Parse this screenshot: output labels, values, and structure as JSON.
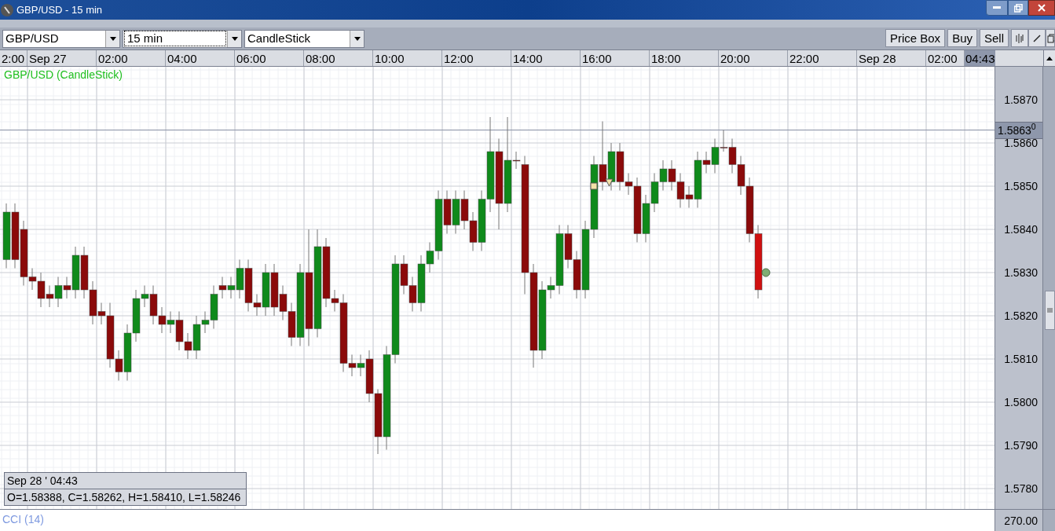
{
  "window": {
    "title": "GBP/USD - 15 min"
  },
  "toolbar": {
    "dropdowns": [
      {
        "value": "GBP/USD",
        "focused": false
      },
      {
        "value": "15 min",
        "focused": true
      },
      {
        "value": "CandleStick",
        "focused": false
      }
    ],
    "buttons": [
      "Price Box",
      "Buy",
      "Sell"
    ]
  },
  "time_axis": {
    "labels": [
      "2:00",
      "Sep 27",
      "02:00",
      "04:00",
      "06:00",
      "08:00",
      "10:00",
      "12:00",
      "14:00",
      "16:00",
      "18:00",
      "20:00",
      "22:00",
      "Sep 28",
      "02:00"
    ],
    "current": "04:43"
  },
  "chart": {
    "legend": "GBP/USD (CandleStick)",
    "price_labels": [
      "1.5870",
      "1.5860",
      "1.5850",
      "1.5840",
      "1.5830",
      "1.5820",
      "1.5810",
      "1.5800",
      "1.5790",
      "1.5780"
    ],
    "price_tag": "1.5863$^{0}$",
    "info_box": {
      "date": "Sep 28 ' 04:43",
      "ohlc": "O=1.58388, C=1.58262, H=1.58410, L=1.58246"
    }
  },
  "indicator": {
    "label": "CCI (14)",
    "axis_label": "270.00"
  }
}
